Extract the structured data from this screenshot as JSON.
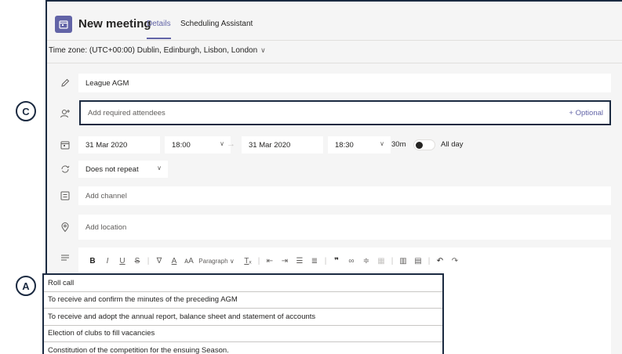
{
  "header": {
    "title": "New meeting",
    "tabs": [
      "Details",
      "Scheduling Assistant"
    ],
    "active_tab": "Details",
    "icon": "calendar-icon"
  },
  "timezone": {
    "label": "Time zone: (UTC+00:00) Dublin, Edinburgh, Lisbon, London",
    "chevron": "∨"
  },
  "form": {
    "title_value": "League AGM",
    "attendees_placeholder": "Add required attendees",
    "optional_link": "+ Optional",
    "start_date": "31 Mar 2020",
    "start_time": "18:00",
    "end_date": "31 Mar 2020",
    "end_time": "18:30",
    "duration": "30m",
    "all_day_label": "All day",
    "all_day": false,
    "repeat": "Does not repeat",
    "channel_placeholder": "Add channel",
    "location_placeholder": "Add location"
  },
  "editor": {
    "toolbar": {
      "bold": "B",
      "italic": "I",
      "underline": "U",
      "strikethrough": "S",
      "paragraph": "Paragraph ∨",
      "quote": "❞"
    },
    "agenda": [
      "Roll call",
      "To receive and confirm the minutes of the preceding AGM",
      "To receive and adopt the annual report, balance sheet and statement of accounts",
      "Election of clubs to fill vacancies",
      "Constitution of the competition for the ensuing Season."
    ]
  },
  "callouts": {
    "c": "C",
    "a": "A"
  },
  "colors": {
    "accent": "#6264a7",
    "annotation": "#1b2a41",
    "background": "#f5f5f5"
  }
}
